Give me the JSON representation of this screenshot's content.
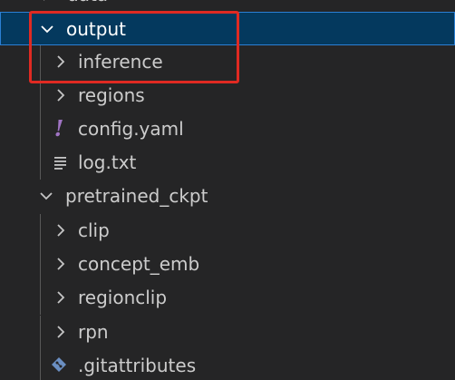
{
  "tree": {
    "top_partial_label": "data",
    "items": [
      {
        "label": "output",
        "expanded": true,
        "selected": true,
        "kind": "folder"
      },
      {
        "label": "inference",
        "expanded": false,
        "kind": "folder"
      },
      {
        "label": "regions",
        "expanded": false,
        "kind": "folder"
      },
      {
        "label": "config.yaml",
        "kind": "file",
        "icon": "yaml-exclamation-icon"
      },
      {
        "label": "log.txt",
        "kind": "file",
        "icon": "text-lines-icon"
      },
      {
        "label": "pretrained_ckpt",
        "expanded": true,
        "kind": "folder"
      },
      {
        "label": "clip",
        "expanded": false,
        "kind": "folder"
      },
      {
        "label": "concept_emb",
        "expanded": false,
        "kind": "folder"
      },
      {
        "label": "regionclip",
        "expanded": false,
        "kind": "folder"
      },
      {
        "label": "rpn",
        "expanded": false,
        "kind": "folder"
      },
      {
        "label": ".gitattributes",
        "kind": "file",
        "icon": "git-diamond-icon"
      }
    ]
  },
  "colors": {
    "background": "#252526",
    "selection": "#04395e",
    "selection_border": "#2b7fd4",
    "highlight_box": "#e02a22",
    "yaml_icon": "#a074c4",
    "git_icon": "#6b8fc2"
  }
}
